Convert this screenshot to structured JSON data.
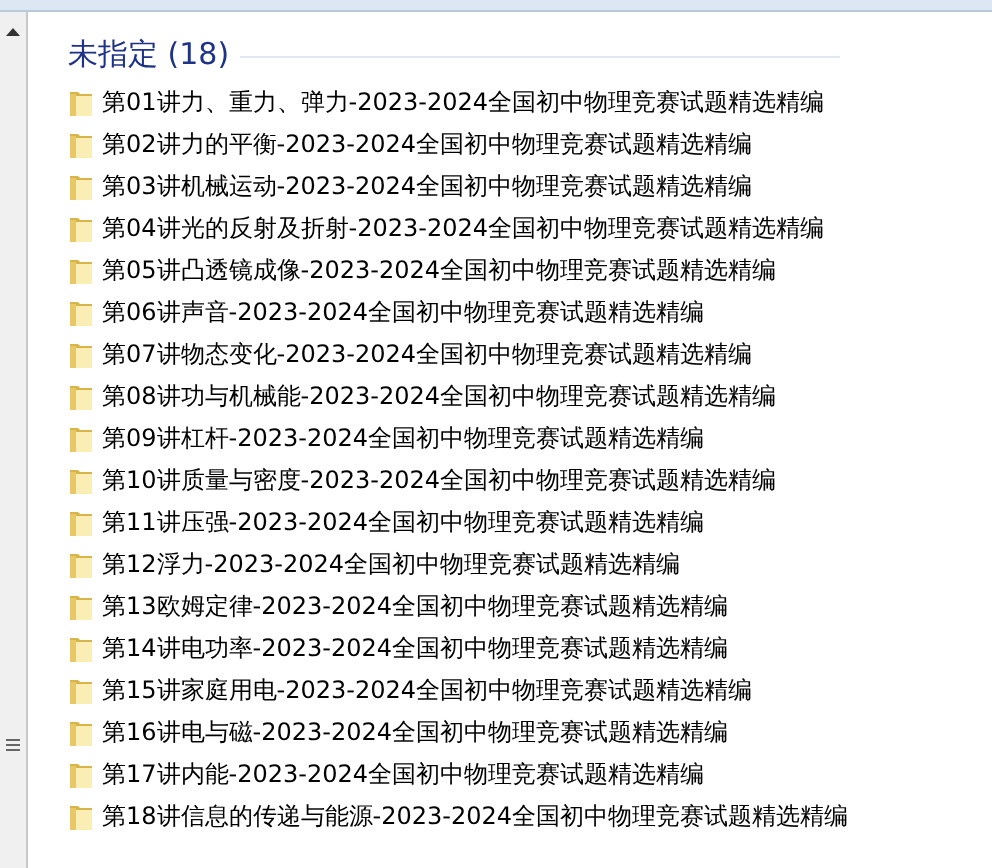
{
  "group": {
    "title": "未指定 (18)",
    "items": [
      {
        "name": "第01讲力、重力、弹力-2023-2024全国初中物理竞赛试题精选精编"
      },
      {
        "name": "第02讲力的平衡-2023-2024全国初中物理竞赛试题精选精编"
      },
      {
        "name": "第03讲机械运动-2023-2024全国初中物理竞赛试题精选精编"
      },
      {
        "name": "第04讲光的反射及折射-2023-2024全国初中物理竞赛试题精选精编"
      },
      {
        "name": "第05讲凸透镜成像-2023-2024全国初中物理竞赛试题精选精编"
      },
      {
        "name": "第06讲声音-2023-2024全国初中物理竞赛试题精选精编"
      },
      {
        "name": "第07讲物态变化-2023-2024全国初中物理竞赛试题精选精编"
      },
      {
        "name": "第08讲功与机械能-2023-2024全国初中物理竞赛试题精选精编"
      },
      {
        "name": "第09讲杠杆-2023-2024全国初中物理竞赛试题精选精编"
      },
      {
        "name": "第10讲质量与密度-2023-2024全国初中物理竞赛试题精选精编"
      },
      {
        "name": "第11讲压强-2023-2024全国初中物理竞赛试题精选精编"
      },
      {
        "name": "第12浮力-2023-2024全国初中物理竞赛试题精选精编"
      },
      {
        "name": "第13欧姆定律-2023-2024全国初中物理竞赛试题精选精编"
      },
      {
        "name": "第14讲电功率-2023-2024全国初中物理竞赛试题精选精编"
      },
      {
        "name": "第15讲家庭用电-2023-2024全国初中物理竞赛试题精选精编"
      },
      {
        "name": "第16讲电与磁-2023-2024全国初中物理竞赛试题精选精编"
      },
      {
        "name": "第17讲内能-2023-2024全国初中物理竞赛试题精选精编"
      },
      {
        "name": "第18讲信息的传递与能源-2023-2024全国初中物理竞赛试题精选精编"
      }
    ]
  }
}
